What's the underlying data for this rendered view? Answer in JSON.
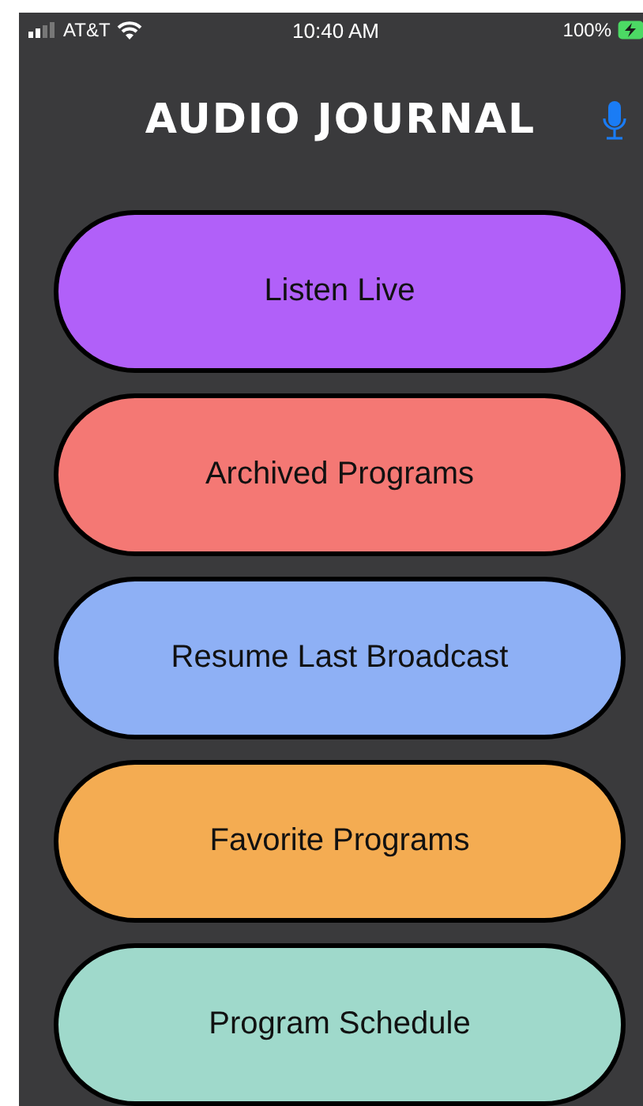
{
  "status_bar": {
    "carrier": "AT&T",
    "time": "10:40 AM",
    "battery": "100%"
  },
  "header": {
    "title": "AUDIO JOURNAL"
  },
  "menu": [
    {
      "label": "Listen Live",
      "color": "#b160f9"
    },
    {
      "label": "Archived Programs",
      "color": "#f47874"
    },
    {
      "label": "Resume Last Broadcast",
      "color": "#8eb0f5"
    },
    {
      "label": "Favorite Programs",
      "color": "#f4ac52"
    },
    {
      "label": "Program Schedule",
      "color": "#9fd9cb"
    }
  ]
}
